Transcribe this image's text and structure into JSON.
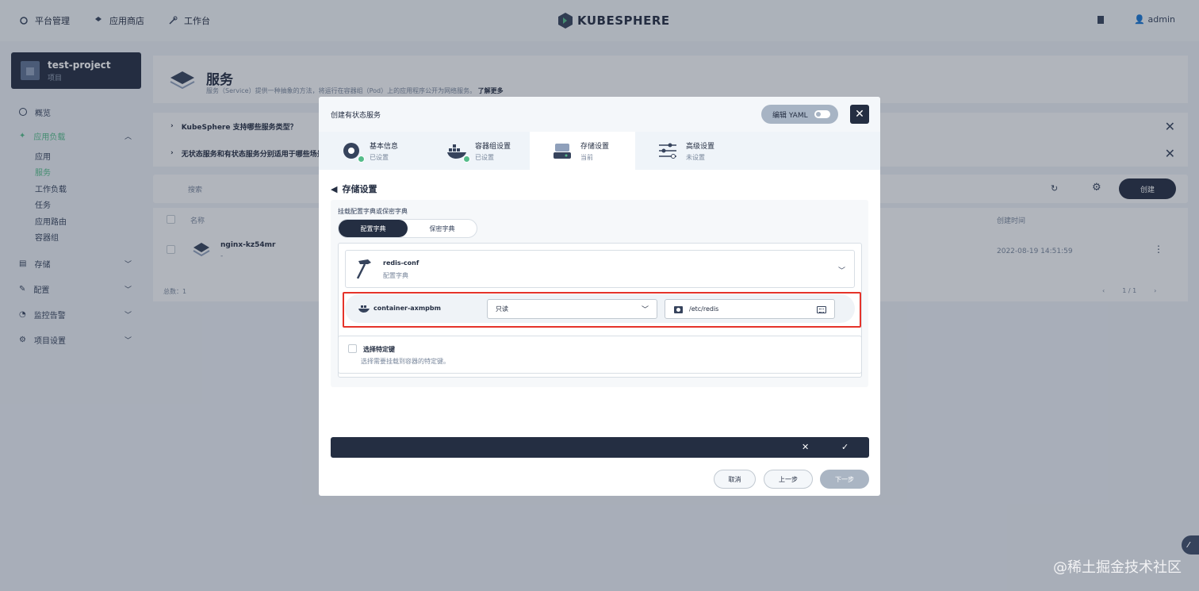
{
  "topbar": {
    "nav": [
      {
        "label": "平台管理",
        "icon": "grid-icon"
      },
      {
        "label": "应用商店",
        "icon": "store-icon"
      },
      {
        "label": "工作台",
        "icon": "tools-icon"
      }
    ],
    "logo_text": "KUBESPHERE",
    "user": "admin"
  },
  "sidebar": {
    "project_name": "test-project",
    "project_sub": "项目",
    "items": [
      {
        "label": "概览"
      },
      {
        "label": "应用负载"
      },
      {
        "label": "存储"
      },
      {
        "label": "配置"
      },
      {
        "label": "监控告警"
      },
      {
        "label": "项目设置"
      }
    ],
    "sub_items": [
      "应用",
      "服务",
      "工作负载",
      "任务",
      "应用路由",
      "容器组"
    ]
  },
  "page": {
    "title": "服务",
    "desc": "服务（Service）提供一种抽象的方法，将运行在容器组（Pod）上的应用程序公开为网络服务。",
    "learn_more": "了解更多",
    "faq1": "KubeSphere 支持哪些服务类型？",
    "faq2": "无状态服务和有状态服务分别适用于哪些场景？",
    "search_placeholder": "搜索",
    "create_label": "创建",
    "col_name": "名称",
    "col_time": "创建时间",
    "row_name": "nginx-kz54mr",
    "row_sub": "-",
    "row_time": "2022-08-19 14:51:59",
    "total": "总数：1",
    "pager": "1 / 1"
  },
  "modal": {
    "title": "创建有状态服务",
    "yaml_label": "编辑 YAML",
    "steps": [
      {
        "label": "基本信息",
        "status": "已设置"
      },
      {
        "label": "容器组设置",
        "status": "已设置"
      },
      {
        "label": "存储设置",
        "status": "当前"
      },
      {
        "label": "高级设置",
        "status": "未设置"
      }
    ],
    "section_title": "存储设置",
    "form_label": "挂载配置字典或保密字典",
    "seg_options": [
      "配置字典",
      "保密字典"
    ],
    "config": {
      "name": "redis-conf",
      "type": "配置字典"
    },
    "mount": {
      "container": "container-axmpbm",
      "mode": "只读",
      "path": "/etc/redis"
    },
    "key_title": "选择特定键",
    "key_desc": "选择需要挂载到容器的特定键。",
    "buttons": {
      "cancel": "取消",
      "prev": "上一步",
      "next": "下一步"
    }
  },
  "watermark": "@稀土掘金技术社区",
  "colors": {
    "accent": "#55bc8a",
    "dark": "#242e42",
    "highlight": "#e5332a"
  }
}
